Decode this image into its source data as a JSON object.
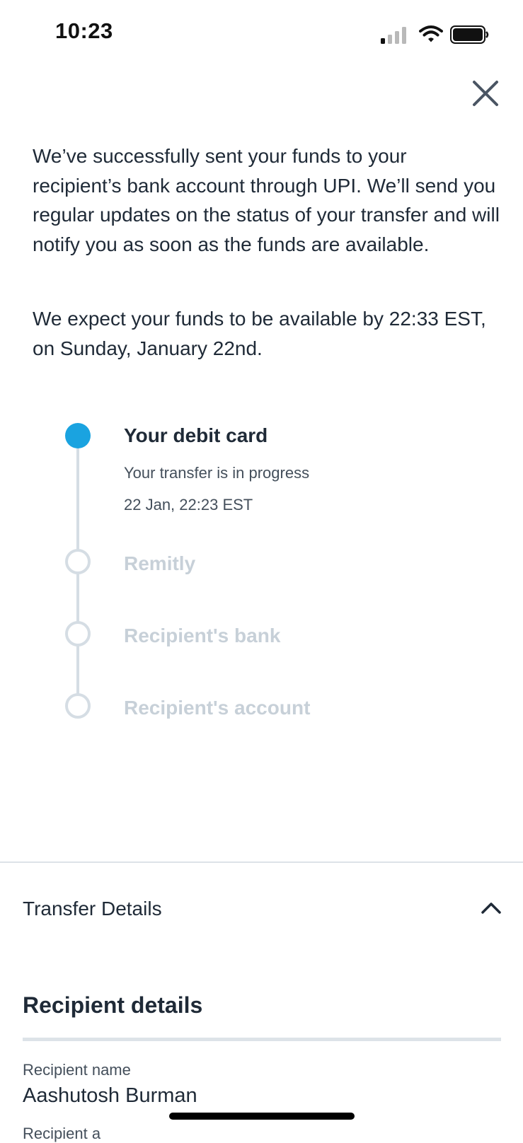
{
  "status_bar": {
    "time": "10:23"
  },
  "message": {
    "paragraph_1": "We’ve successfully sent your funds to your recipient’s bank account through UPI. We’ll send you regular updates on the status of your transfer and will notify you as soon as the funds are available.",
    "paragraph_2": "We expect your funds to be available by 22:33 EST, on Sunday, January 22nd."
  },
  "timeline": {
    "steps": [
      {
        "title": "Your debit card",
        "status_text": "Your transfer is in progress",
        "timestamp": "22 Jan, 22:23 EST",
        "state": "active"
      },
      {
        "title": "Remitly",
        "state": "pending"
      },
      {
        "title": "Recipient's bank",
        "state": "pending"
      },
      {
        "title": "Recipient's account",
        "state": "pending"
      }
    ]
  },
  "transfer_details": {
    "label": "Transfer Details",
    "expanded": true
  },
  "recipient_details": {
    "heading": "Recipient details",
    "name_label": "Recipient name",
    "name_value": "Aashutosh Burman",
    "next_label": "Recipient a"
  },
  "colors": {
    "accent": "#1aa3e0",
    "pending": "#d5dde4",
    "text": "#1f2a37"
  }
}
